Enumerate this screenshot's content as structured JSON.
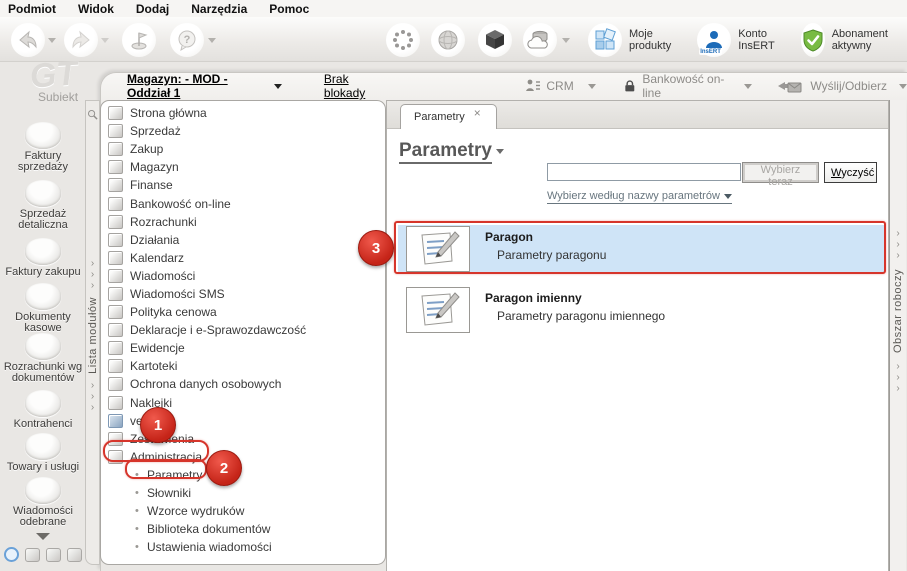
{
  "menu_bar": {
    "items": [
      "Podmiot",
      "Widok",
      "Dodaj",
      "Narzędzia",
      "Pomoc"
    ]
  },
  "toolbar": {
    "products_line1": "Moje",
    "products_line2": "produkty",
    "konto_line1": "Konto",
    "konto_line2": "InsERT",
    "insert_badge": "InsERT",
    "subscription_label": "Abonament aktywny"
  },
  "status_bar": {
    "warehouse_link": "Magazyn: - MOD - Oddział 1",
    "lock_link": "Brak blokady",
    "crm_label": "CRM",
    "banking_label": "Bankowość on-line",
    "send_label": "Wyślij/Odbierz"
  },
  "sidebar": {
    "logo": "GT",
    "brand": "Subiekt",
    "items": [
      "Faktury sprzedaży",
      "Sprzedaż detaliczna",
      "Faktury zakupu",
      "Dokumenty kasowe",
      "Rozrachunki wg dokumentów",
      "Kontrahenci",
      "Towary i usługi",
      "Wiadomości odebrane"
    ]
  },
  "module_strip": {
    "label": "Lista modułów"
  },
  "workspace_strip": {
    "label": "Obszar roboczy"
  },
  "modules": {
    "items": [
      "Strona główna",
      "Sprzedaż",
      "Zakup",
      "Magazyn",
      "Finanse",
      "Bankowość on-line",
      "Rozrachunki",
      "Działania",
      "Kalendarz",
      "Wiadomości",
      "Wiadomości SMS",
      "Polityka cenowa",
      "Deklaracje i e-Sprawozdawczość",
      "Ewidencje",
      "Kartoteki",
      "Ochrona danych osobowych",
      "Naklejki",
      "vendero",
      "Zestawienia",
      "Administracja"
    ],
    "admin_children": [
      "Parametry",
      "Słowniki",
      "Wzorce wydruków",
      "Biblioteka dokumentów",
      "Ustawienia wiadomości"
    ]
  },
  "main": {
    "tab_label": "Parametry",
    "title": "Parametry",
    "search": {
      "value": "",
      "select_button": "Wybierz teraz",
      "clear_accel": "W",
      "clear_rest": "yczyść",
      "filter_link": "Wybierz według nazwy parametrów"
    },
    "items": [
      {
        "title": "Paragon",
        "subtitle": "Parametry paragonu"
      },
      {
        "title": "Paragon imienny",
        "subtitle": "Parametry paragonu imiennego"
      }
    ]
  },
  "annotations": {
    "step1": "1",
    "step2": "2",
    "step3": "3"
  },
  "icons": {
    "close": "×",
    "chevron": "›",
    "bullet": "•"
  },
  "colors": {
    "annotation_red": "#d6352b",
    "selection_blue": "#cfe4f7",
    "accent_blue": "#1c6bb8",
    "shield_green": "#6fb53c"
  }
}
